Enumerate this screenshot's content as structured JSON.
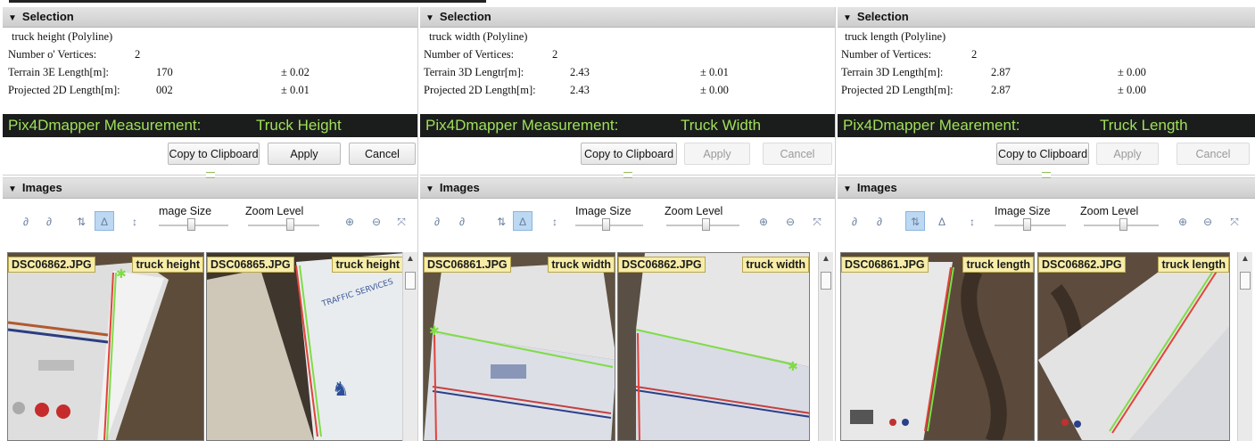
{
  "colors": {
    "measure_bg": "#1b1d1c",
    "measure_text": "#9fe05a",
    "tag_bg": "#f7eda8",
    "line_red": "#e0443a",
    "line_green": "#7fdc46"
  },
  "panels": [
    {
      "selection_header": "Selection",
      "object": "truck height (Polyline)",
      "vertices_label": "Number o' Vertices:",
      "vertices": "2",
      "terrain_label": "Terrain 3E Length[m]:",
      "terrain_value": "170",
      "terrain_err": "± 0.02",
      "projected_label": "Projected 2D Length[m]:",
      "projected_value": "002",
      "projected_err": "± 0.01",
      "measure_label": "Pix4Dmapper Measurement:",
      "measure_name": "Truck Height",
      "copy_label": "Copy to Clipboard",
      "apply_label": "Apply",
      "cancel_label": "Cancel",
      "images_header": "Images",
      "image_size_label": "mage Size",
      "zoom_label": "Zoom Level",
      "images": [
        {
          "file": "DSC06862.JPG",
          "tag": "truck height"
        },
        {
          "file": "DSC06865.JPG",
          "tag": "truck height"
        }
      ]
    },
    {
      "selection_header": "Selection",
      "object": "truck width (Polyline)",
      "vertices_label": "Number of Vertices:",
      "vertices": "2",
      "terrain_label": "Terrain 3D Lengtr[m]:",
      "terrain_value": "2.43",
      "terrain_err": "± 0.01",
      "projected_label": "Projected 2D Length[m]:",
      "projected_value": "2.43",
      "projected_err": "± 0.00",
      "measure_label": "Pix4Dmapper Measurement:",
      "measure_name": "Truck Width",
      "copy_label": "Copy to Clipboard",
      "apply_label": "Apply",
      "cancel_label": "Cancel",
      "images_header": "Images",
      "image_size_label": "Image Size",
      "zoom_label": "Zoom Level",
      "images": [
        {
          "file": "DSC06861.JPG",
          "tag": "truck width"
        },
        {
          "file": "DSC06862.JPG",
          "tag": "truck width"
        }
      ]
    },
    {
      "selection_header": "Selection",
      "object": "truck length (Polyline)",
      "vertices_label": "Number of Vertices:",
      "vertices": "2",
      "terrain_label": "Terrain 3D Length[m]:",
      "terrain_value": "2.87",
      "terrain_err": "± 0.00",
      "projected_label": "Projected 2D Length[m]:",
      "projected_value": "2.87",
      "projected_err": "± 0.00",
      "measure_label": "Pix4Dmapper Mearement:",
      "measure_name": "Truck Length",
      "copy_label": "Copy to Clipboard",
      "apply_label": "Apply",
      "cancel_label": "Cancel",
      "images_header": "Images",
      "image_size_label": "Image Size",
      "zoom_label": "Zoom Level",
      "images": [
        {
          "file": "DSC06861.JPG",
          "tag": "truck length"
        },
        {
          "file": "DSC06862.JPG",
          "tag": "truck length"
        }
      ]
    }
  ]
}
